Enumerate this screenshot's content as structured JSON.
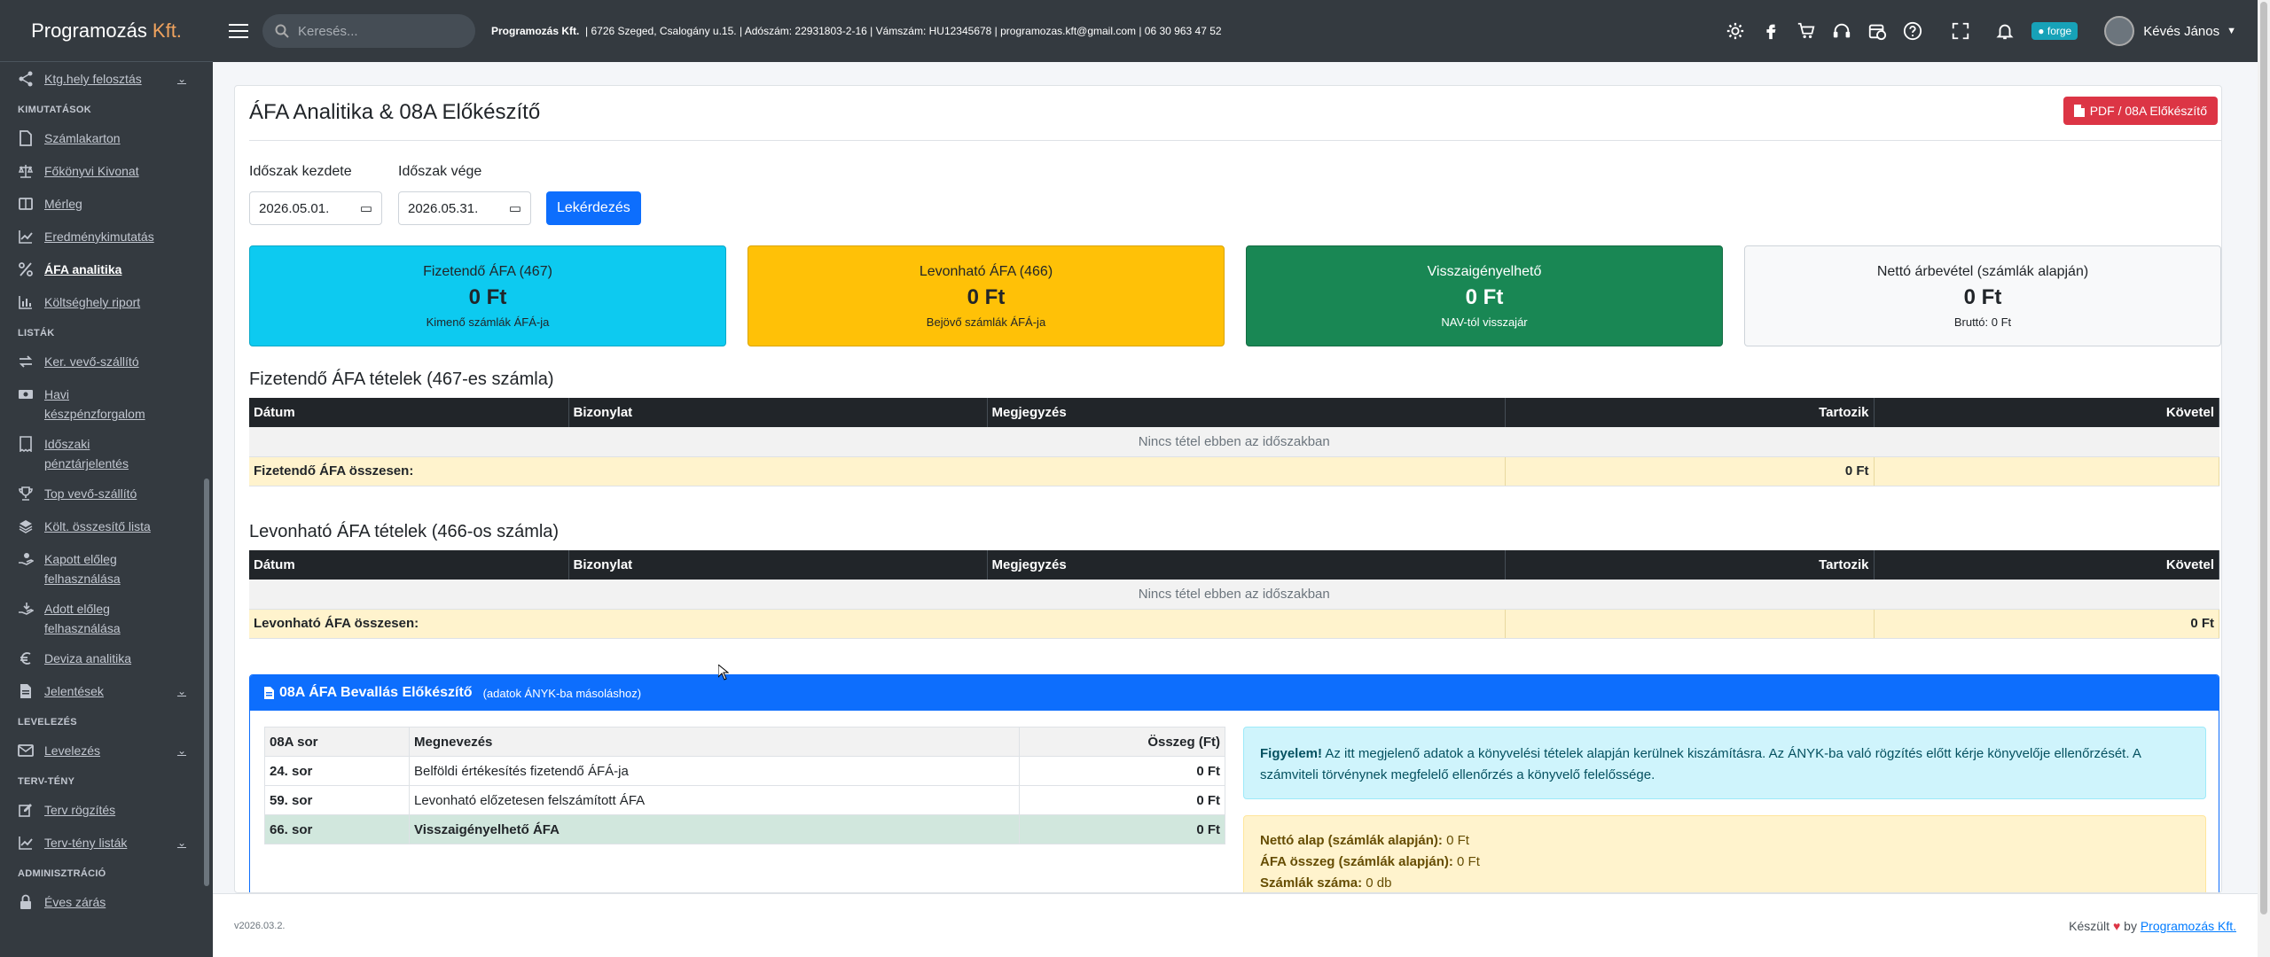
{
  "brand": {
    "name": "Programozás",
    "accent": "Kft."
  },
  "sidebar": {
    "items": [
      {
        "type": "item",
        "label": "Ktg.hely felosztás",
        "icon": "share-icon",
        "chev": true
      },
      {
        "type": "section",
        "label": "KIMUTATÁSOK"
      },
      {
        "type": "item",
        "label": "Számlakarton",
        "icon": "file-icon"
      },
      {
        "type": "item",
        "label": "Főkönyvi Kivonat",
        "icon": "balance-scale-icon"
      },
      {
        "type": "item",
        "label": "Mérleg",
        "icon": "book-icon"
      },
      {
        "type": "item",
        "label": "Eredménykimutatás",
        "icon": "line-chart-icon"
      },
      {
        "type": "item",
        "label": "ÁFA analitika",
        "icon": "percent-icon",
        "active": true
      },
      {
        "type": "item",
        "label": "Költséghely riport",
        "icon": "bar-chart-icon"
      },
      {
        "type": "section",
        "label": "LISTÁK"
      },
      {
        "type": "item",
        "label": "Ker. vevő-szállító",
        "icon": "exchange-icon"
      },
      {
        "type": "item",
        "label": "Havi készpénzforgalom",
        "icon": "money-icon",
        "multi": true
      },
      {
        "type": "item",
        "label": "Időszaki pénztárjelentés",
        "icon": "receipt-icon",
        "multi": true
      },
      {
        "type": "item",
        "label": "Top vevő-szállító",
        "icon": "trophy-icon"
      },
      {
        "type": "item",
        "label": "Költ. összesítő lista",
        "icon": "layers-icon"
      },
      {
        "type": "item",
        "label": "Kapott előleg felhasználása",
        "icon": "hand-holding-icon",
        "multi": true
      },
      {
        "type": "item",
        "label": "Adott előleg felhasználása",
        "icon": "hand-give-icon",
        "multi": true
      },
      {
        "type": "item",
        "label": "Deviza analitika",
        "icon": "euro-icon"
      },
      {
        "type": "item",
        "label": "Jelentések",
        "icon": "document-icon",
        "chev": true
      },
      {
        "type": "section",
        "label": "LEVELEZÉS"
      },
      {
        "type": "item",
        "label": "Levelezés",
        "icon": "envelope-icon",
        "chev": true
      },
      {
        "type": "section",
        "label": "TERV-TÉNY"
      },
      {
        "type": "item",
        "label": "Terv rögzítés",
        "icon": "edit-icon"
      },
      {
        "type": "item",
        "label": "Terv-tény listák",
        "icon": "line-chart-icon",
        "chev": true
      },
      {
        "type": "section",
        "label": "ADMINISZTRÁCIÓ"
      },
      {
        "type": "item",
        "label": "Éves zárás",
        "icon": "lock-icon"
      }
    ]
  },
  "topbar": {
    "search_placeholder": "Keresés...",
    "company_name": "Programozás Kft.",
    "company_info": "|  6726 Szeged, Csalogány u.15.  |  Adószám: 22931803-2-16  |  Vámszám: HU12345678  |  programozas.kft@gmail.com  |  06 30 963 47 52",
    "forge_label": "forge",
    "user_name": "Kévés János"
  },
  "page": {
    "title": "ÁFA Analitika & 08A Előkészítő",
    "pdf_button": "PDF / 08A Előkészítő",
    "start_label": "Időszak kezdete",
    "start_value": "2026.05.01.",
    "end_label": "Időszak vége",
    "end_value": "2026.05.31.",
    "query_button": "Lekérdezés"
  },
  "cards": [
    {
      "title": "Fizetendő ÁFA (467)",
      "value": "0 Ft",
      "sub": "Kimenő számlák ÁFÁ-ja"
    },
    {
      "title": "Levonható ÁFA (466)",
      "value": "0 Ft",
      "sub": "Bejövő számlák ÁFÁ-ja"
    },
    {
      "title": "Visszaigényelhető",
      "value": "0 Ft",
      "sub": "NAV-tól visszajár"
    },
    {
      "title": "Nettó árbevétel (számlák alapján)",
      "value": "0 Ft",
      "sub": "Bruttó: 0 Ft"
    }
  ],
  "table467": {
    "heading": "Fizetendő ÁFA tételek (467-es számla)",
    "columns": [
      "Dátum",
      "Bizonylat",
      "Megjegyzés",
      "Tartozik",
      "Követel"
    ],
    "empty": "Nincs tétel ebben az időszakban",
    "sum_label": "Fizetendő ÁFA összesen:",
    "sum_tartozik": "0 Ft",
    "sum_kovetel": ""
  },
  "table466": {
    "heading": "Levonható ÁFA tételek (466-os számla)",
    "columns": [
      "Dátum",
      "Bizonylat",
      "Megjegyzés",
      "Tartozik",
      "Követel"
    ],
    "empty": "Nincs tétel ebben az időszakban",
    "sum_label": "Levonható ÁFA összesen:",
    "sum_tartozik": "",
    "sum_kovetel": "0 Ft"
  },
  "panel08a": {
    "title": "08A ÁFA Bevallás Előkészítő",
    "subtitle": "(adatok ÁNYK-ba másoláshoz)",
    "columns": [
      "08A sor",
      "Megnevezés",
      "Összeg (Ft)"
    ],
    "rows": [
      {
        "sor": "24. sor",
        "name": "Belföldi értékesítés fizetendő ÁFÁ-ja",
        "amount": "0 Ft"
      },
      {
        "sor": "59. sor",
        "name": "Levonható előzetesen felszámított ÁFA",
        "amount": "0 Ft"
      },
      {
        "sor": "66. sor",
        "name": "Visszaigényelhető ÁFA",
        "amount": "0 Ft"
      }
    ],
    "alert_bold": "Figyelem!",
    "alert_text": " Az itt megjelenő adatok a könyvelési tételek alapján kerülnek kiszámításra. Az ÁNYK-ba való rögzítés előtt kérje könyvelője ellenőrzését. A számviteli törvénynek megfelelő ellenőrzés a könyvelő felelőssége.",
    "netto_label": "Nettó alap (számlák alapján):",
    "netto_value": " 0 Ft",
    "afa_label": "ÁFA összeg (számlák alapján):",
    "afa_value": " 0 Ft",
    "count_label": "Számlák száma:",
    "count_value": " 0 db"
  },
  "footer": {
    "version": "v2026.03.2.",
    "made": "Készült",
    "by": "by",
    "link": "Programozás Kft."
  },
  "colors": {
    "sidebar": "#343a40",
    "primary": "#0d6efd",
    "danger": "#dc3545",
    "info": "#0dcaf0",
    "warning": "#ffc107",
    "success": "#198754"
  }
}
